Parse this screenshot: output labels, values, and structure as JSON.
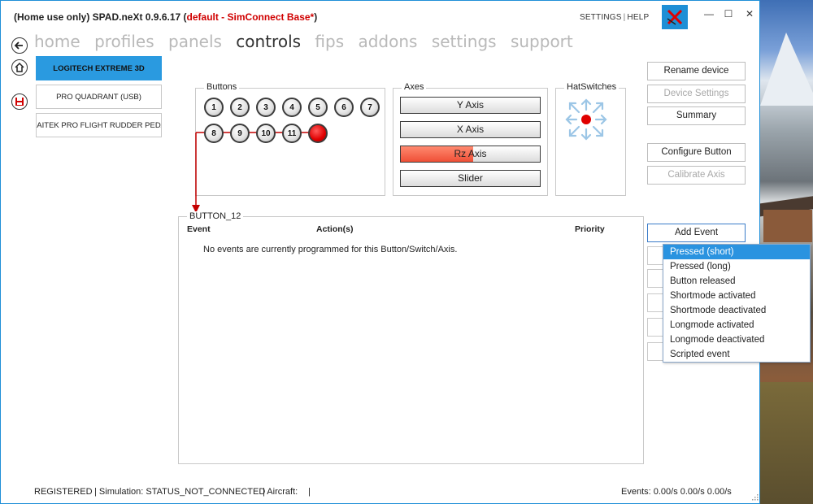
{
  "window": {
    "title_prefix": "(Home use only) SPAD.neXt 0.9.6.17 (",
    "title_profile": "default - SimConnect Base*",
    "title_suffix": ")",
    "settings_link": "SETTINGS",
    "help_link": "HELP",
    "minimize": "—",
    "maximize": "☐",
    "close": "✕"
  },
  "menu": {
    "items": [
      "home",
      "profiles",
      "panels",
      "controls",
      "fips",
      "addons",
      "settings",
      "support"
    ],
    "active": "controls"
  },
  "devices": [
    "LOGITECH EXTREME 3D",
    "PRO QUADRANT (USB)",
    "SAITEK PRO FLIGHT RUDDER PEDA"
  ],
  "buttons_group": {
    "label": "Buttons",
    "buttons": [
      "1",
      "2",
      "3",
      "4",
      "5",
      "6",
      "7",
      "8",
      "9",
      "10",
      "11",
      ""
    ],
    "selected_index": 11
  },
  "axes_group": {
    "label": "Axes",
    "axes": [
      {
        "label": "Y Axis",
        "level": 0
      },
      {
        "label": "X Axis",
        "level": 0
      },
      {
        "label": "Rz Axis",
        "level": 0.52
      },
      {
        "label": "Slider",
        "level": 0
      }
    ]
  },
  "hat_group": {
    "label": "HatSwitches"
  },
  "right_buttons": {
    "rename": "Rename device",
    "device_settings": "Device Settings",
    "summary": "Summary",
    "configure": "Configure Button",
    "calibrate": "Calibrate Axis",
    "add_event": "Add Event"
  },
  "events_panel": {
    "label": "BUTTON_12",
    "col_event": "Event",
    "col_actions": "Action(s)",
    "col_priority": "Priority",
    "empty_message": "No events are currently programmed for this Button/Switch/Axis."
  },
  "dropdown": {
    "items": [
      "Pressed (short)",
      "Pressed (long)",
      "Button released",
      "Shortmode activated",
      "Shortmode deactivated",
      "Longmode activated",
      "Longmode deactivated",
      "Scripted event"
    ],
    "highlighted_index": 0
  },
  "status": {
    "registered": "REGISTERED",
    "simulation": "| Simulation: STATUS_NOT_CONNECTED",
    "aircraft": "| Aircraft:",
    "aircraft_sep": "|",
    "events": "Events: 0.00/s 0.00/s 0.00/s"
  },
  "colors": {
    "accent": "#2a9ae0",
    "selected_button": "#e00000",
    "axis_fill": "#ef4f36",
    "title_red": "#d00000"
  }
}
